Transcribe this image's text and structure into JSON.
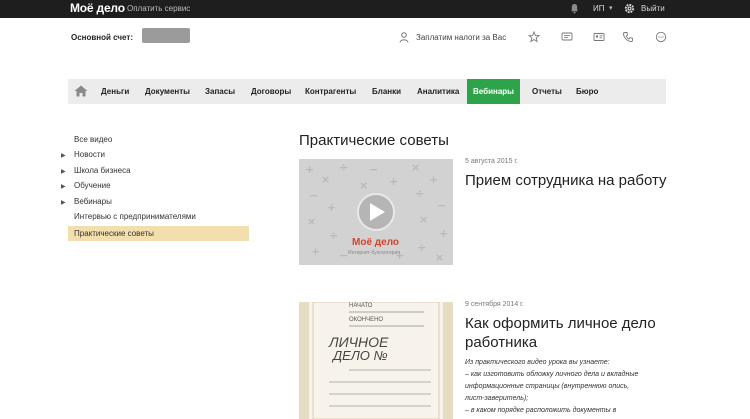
{
  "topbar": {
    "logo": "Моё дело",
    "pay_link": "Оплатить сервис",
    "user_menu": "ИП",
    "logout": "Выйти"
  },
  "header": {
    "account_label": "Основной счет:",
    "taxes_link": "Заплатим налоги за Вас"
  },
  "nav": {
    "items": [
      {
        "label": "Деньги"
      },
      {
        "label": "Документы"
      },
      {
        "label": "Запасы"
      },
      {
        "label": "Договоры"
      },
      {
        "label": "Контрагенты"
      },
      {
        "label": "Бланки"
      },
      {
        "label": "Аналитика"
      },
      {
        "label": "Вебинары",
        "active": true
      },
      {
        "label": "Отчеты"
      },
      {
        "label": "Бюро"
      }
    ]
  },
  "sidebar": {
    "items": [
      {
        "label": "Все видео"
      },
      {
        "label": "Новости"
      },
      {
        "label": "Школа бизнеса"
      },
      {
        "label": "Обучение"
      },
      {
        "label": "Вебинары"
      },
      {
        "label": "Интервью с предпринимателями"
      },
      {
        "label": "Практические советы"
      }
    ]
  },
  "main": {
    "title": "Практические советы",
    "articles": [
      {
        "date": "5 августа 2015 г.",
        "title": "Прием сотрудника на работу",
        "thumb_logo": "Моё дело",
        "thumb_tagline": "Интернет-бухгалтерия"
      },
      {
        "date": "9 сентября 2014 г.",
        "title_line1": "Как оформить личное дело",
        "title_line2": "работника",
        "desc": [
          "Из практического видео урока вы узнаете:",
          "– как изготовить обложку личного дела и вкладные",
          "информационные страницы (внутреннюю опись,",
          "лист-заверитель);",
          "– в каком порядке расположить документы в"
        ],
        "thumb_started": "НАЧАТО",
        "thumb_finished": "ОКОНЧЕНО",
        "thumb_title1": "ЛИЧНОЕ",
        "thumb_title2": "ДЕЛО №"
      }
    ]
  },
  "colors": {
    "topbar_bg": "#1e1e1e",
    "nav_active": "#2ea44a",
    "sidebar_active": "#f3dfae",
    "thumb_logo_red": "#d0452e"
  }
}
